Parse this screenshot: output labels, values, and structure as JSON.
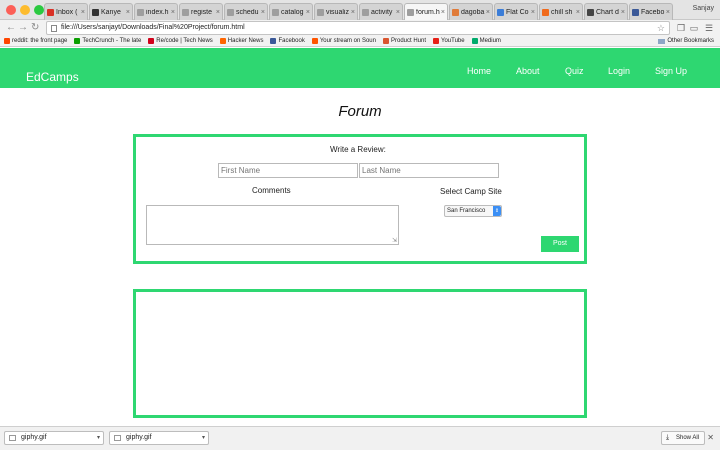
{
  "browser": {
    "tabs": [
      {
        "label": "Inbox (",
        "favicon_color": "#d93025",
        "active": false
      },
      {
        "label": "Kanye",
        "favicon_color": "#333333",
        "active": false
      },
      {
        "label": "index.h",
        "favicon_color": "#9e9e9e",
        "active": false
      },
      {
        "label": "registe",
        "favicon_color": "#9e9e9e",
        "active": false
      },
      {
        "label": "schedu",
        "favicon_color": "#9e9e9e",
        "active": false
      },
      {
        "label": "catalog",
        "favicon_color": "#9e9e9e",
        "active": false
      },
      {
        "label": "visualiz",
        "favicon_color": "#9e9e9e",
        "active": false
      },
      {
        "label": "activity",
        "favicon_color": "#9e9e9e",
        "active": false
      },
      {
        "label": "forum.h",
        "favicon_color": "#9e9e9e",
        "active": true
      },
      {
        "label": "dagoba",
        "favicon_color": "#e07b39",
        "active": false
      },
      {
        "label": "Flat Co",
        "favicon_color": "#3b7dd8",
        "active": false
      },
      {
        "label": "chill sh",
        "favicon_color": "#f06a1c",
        "active": false
      },
      {
        "label": "Chart d",
        "favicon_color": "#444444",
        "active": false
      },
      {
        "label": "Facebo",
        "favicon_color": "#3b5998",
        "active": false
      }
    ],
    "user": "Sanjay",
    "url": "file:///Users/sanjayt/Downloads/Final%20Project/forum.html",
    "bookmarks": [
      {
        "label": "reddit: the front page",
        "favicon_color": "#ff4500"
      },
      {
        "label": "TechCrunch - The late",
        "favicon_color": "#0a9e01"
      },
      {
        "label": "Re/code | Tech News",
        "favicon_color": "#d0021b"
      },
      {
        "label": "Hacker News",
        "favicon_color": "#ff6600"
      },
      {
        "label": "Facebook",
        "favicon_color": "#3b5998"
      },
      {
        "label": "Your stream on Soun",
        "favicon_color": "#ff5500"
      },
      {
        "label": "Product Hunt",
        "favicon_color": "#da552f"
      },
      {
        "label": "YouTube",
        "favicon_color": "#e62117"
      },
      {
        "label": "Medium",
        "favicon_color": "#00ab6c"
      }
    ],
    "other_bookmarks": "Other Bookmarks"
  },
  "site": {
    "brand": "EdCamps",
    "nav": [
      "Home",
      "About",
      "Quiz",
      "Login",
      "Sign Up"
    ],
    "accent_color": "#2ed771"
  },
  "forum": {
    "title": "Forum",
    "review_heading": "Write a Review:",
    "first_name_placeholder": "First Name",
    "last_name_placeholder": "Last Name",
    "comments_label": "Comments",
    "camp_label": "Select Camp Site",
    "camp_selected": "San Francisco",
    "post_label": "Post"
  },
  "downloads": {
    "items": [
      "giphy.gif",
      "giphy.gif"
    ],
    "show_all": "Show All"
  }
}
